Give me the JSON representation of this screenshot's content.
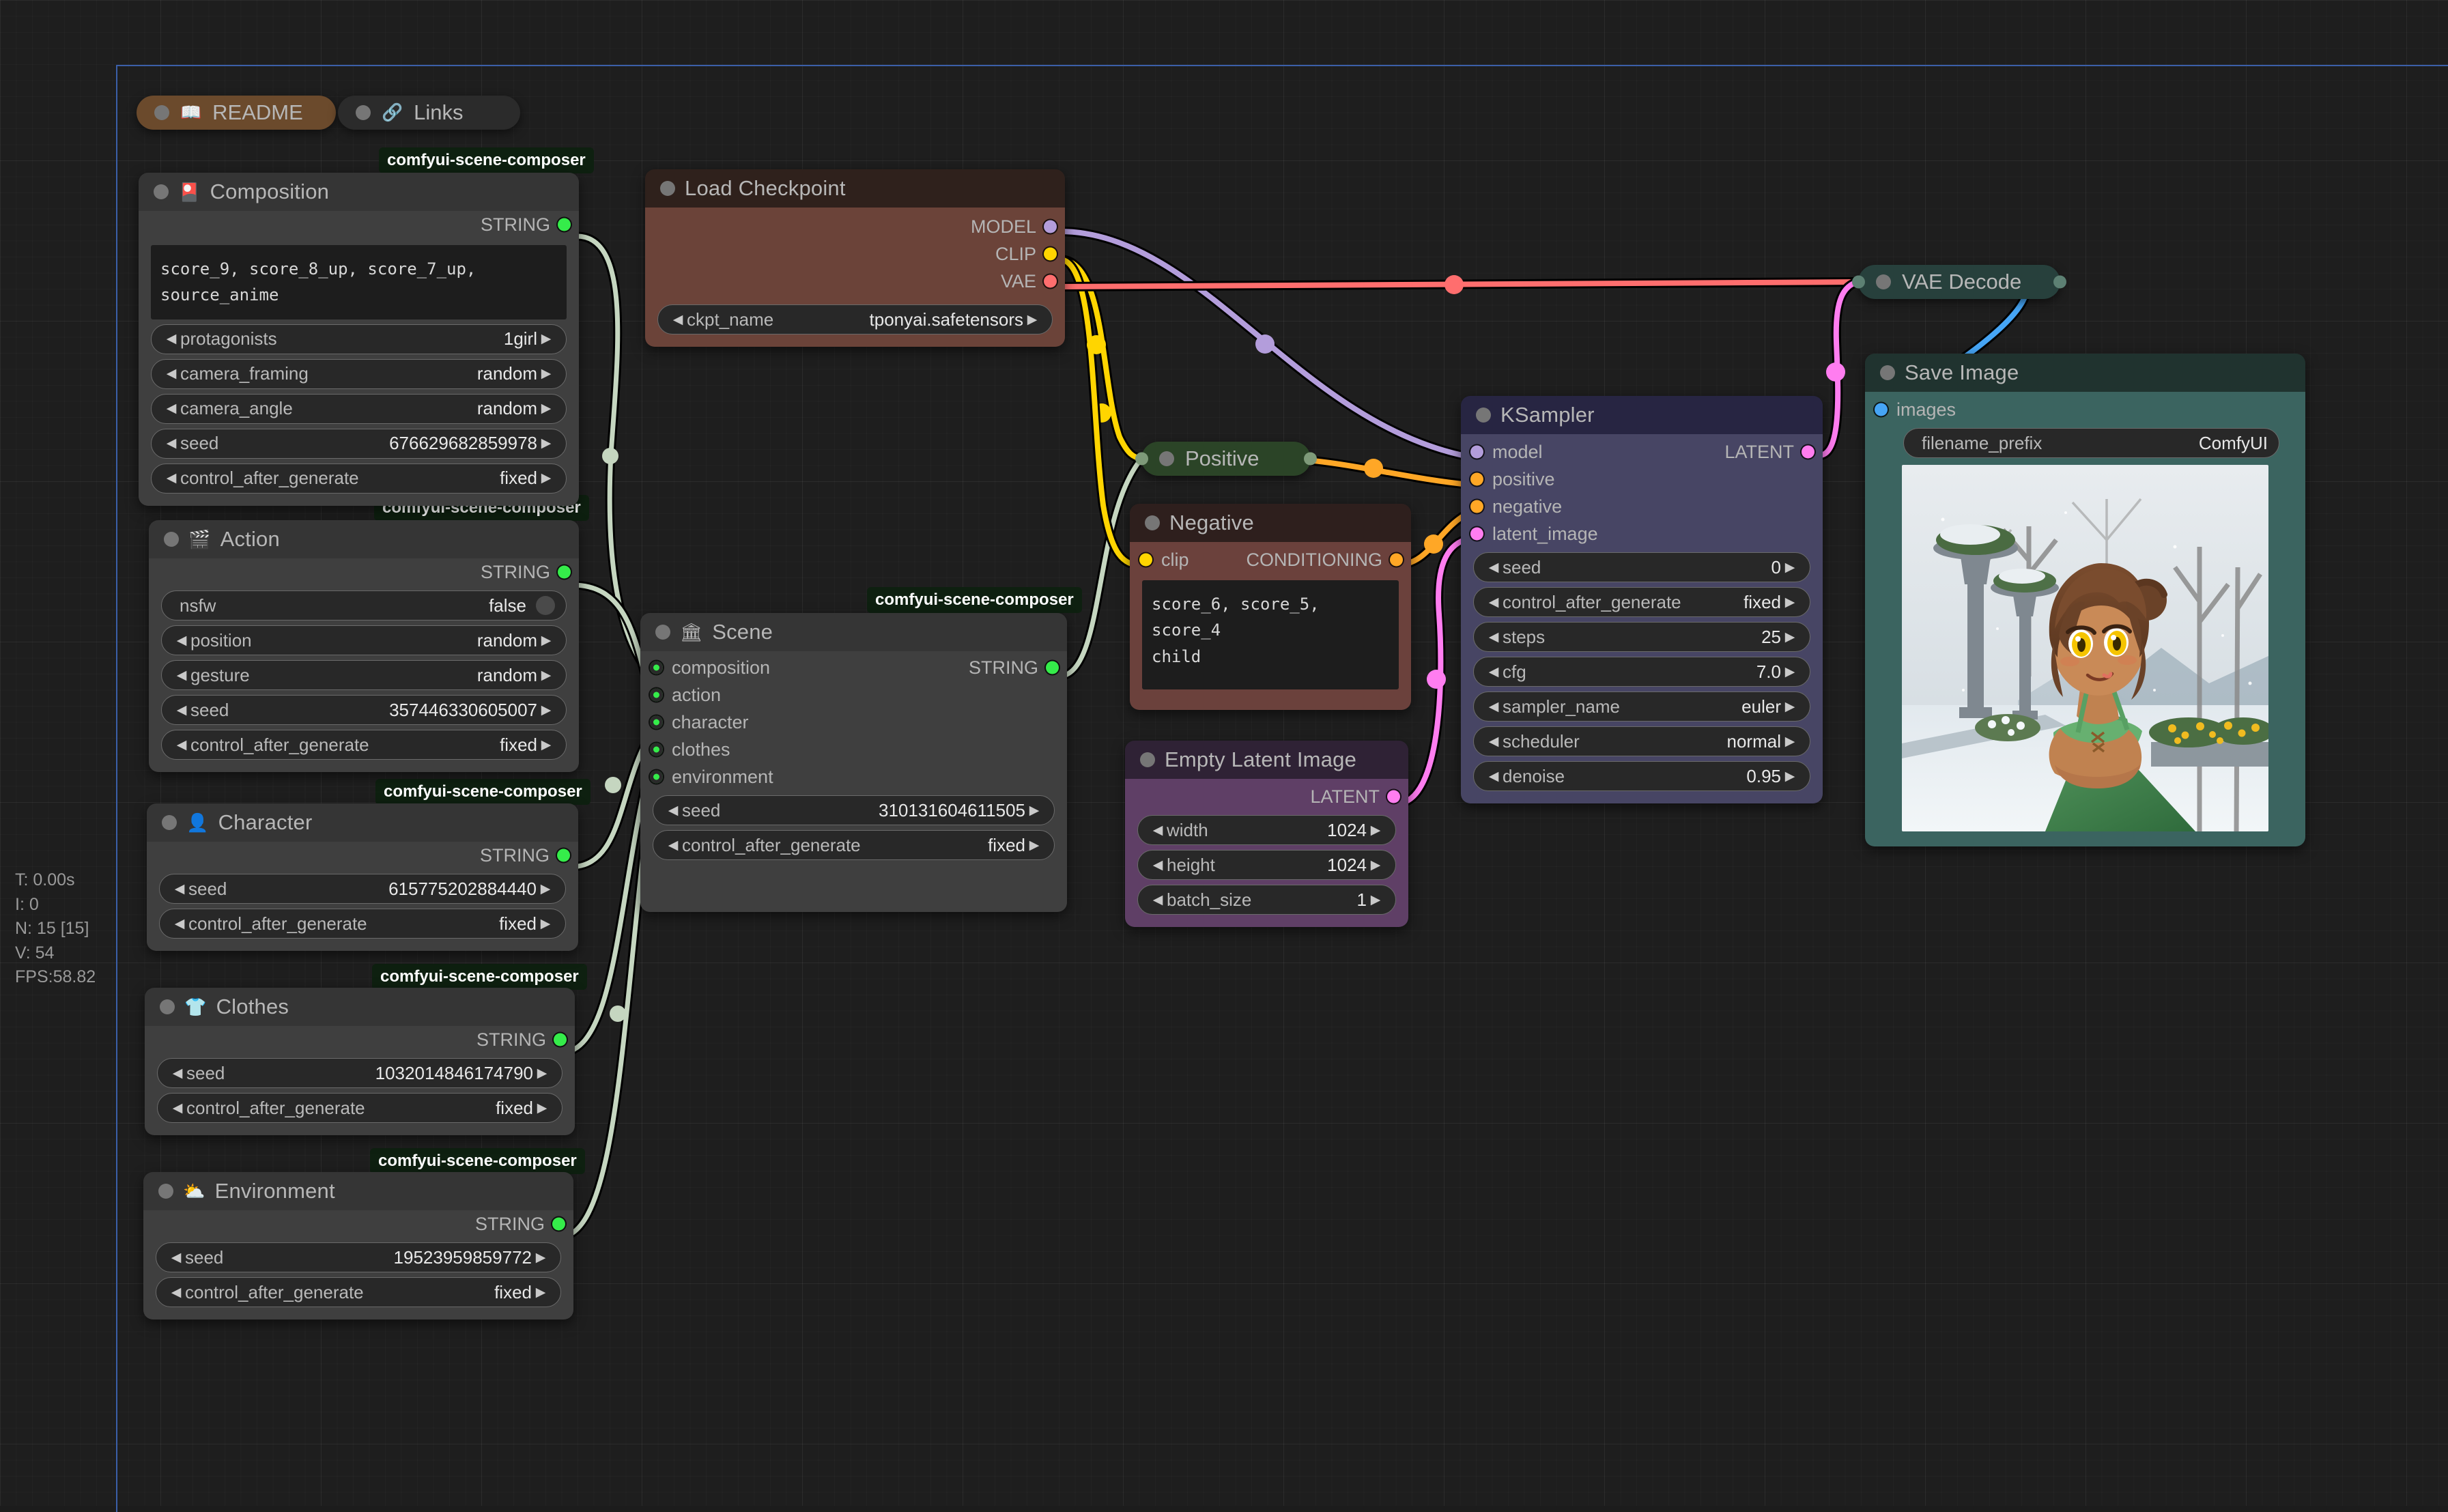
{
  "stats": {
    "time": "T: 0.00s",
    "iterations": "I: 0",
    "nodes": "N: 15 [15]",
    "version": "V: 54",
    "fps": "FPS:58.82"
  },
  "group_badge": "comfyui-scene-composer",
  "pills": {
    "readme": {
      "label": "README",
      "icon": "book-icon",
      "glyph": "📖"
    },
    "links": {
      "label": "Links",
      "icon": "link-icon",
      "glyph": "🔗"
    },
    "positive": {
      "label": "Positive"
    },
    "vae_decode": {
      "label": "VAE Decode"
    }
  },
  "nodes": {
    "composition": {
      "title": "Composition",
      "icon_glyph": "🎴",
      "output_label": "STRING",
      "prompt_text": "score_9, score_8_up, score_7_up, source_anime",
      "widgets": [
        {
          "label": "protagonists",
          "value": "1girl"
        },
        {
          "label": "camera_framing",
          "value": "random"
        },
        {
          "label": "camera_angle",
          "value": "random"
        },
        {
          "label": "seed",
          "value": "676629682859978"
        },
        {
          "label": "control_after_generate",
          "value": "fixed"
        }
      ]
    },
    "action": {
      "title": "Action",
      "icon_glyph": "🎬",
      "output_label": "STRING",
      "toggle": {
        "label": "nsfw",
        "value": "false"
      },
      "widgets": [
        {
          "label": "position",
          "value": "random"
        },
        {
          "label": "gesture",
          "value": "random"
        },
        {
          "label": "seed",
          "value": "357446330605007"
        },
        {
          "label": "control_after_generate",
          "value": "fixed"
        }
      ]
    },
    "character": {
      "title": "Character",
      "icon_glyph": "👤",
      "output_label": "STRING",
      "widgets": [
        {
          "label": "seed",
          "value": "615775202884440"
        },
        {
          "label": "control_after_generate",
          "value": "fixed"
        }
      ]
    },
    "clothes": {
      "title": "Clothes",
      "icon_glyph": "👕",
      "output_label": "STRING",
      "widgets": [
        {
          "label": "seed",
          "value": "1032014846174790"
        },
        {
          "label": "control_after_generate",
          "value": "fixed"
        }
      ]
    },
    "environment": {
      "title": "Environment",
      "icon_glyph": "⛅",
      "output_label": "STRING",
      "widgets": [
        {
          "label": "seed",
          "value": "19523959859772"
        },
        {
          "label": "control_after_generate",
          "value": "fixed"
        }
      ]
    },
    "load_checkpoint": {
      "title": "Load Checkpoint",
      "outputs": [
        "MODEL",
        "CLIP",
        "VAE"
      ],
      "widgets": [
        {
          "label": "ckpt_name",
          "value": "tponyai.safetensors"
        }
      ]
    },
    "scene": {
      "title": "Scene",
      "icon_glyph": "🏛",
      "inputs": [
        "composition",
        "action",
        "character",
        "clothes",
        "environment"
      ],
      "output_label": "STRING",
      "widgets": [
        {
          "label": "seed",
          "value": "310131604611505"
        },
        {
          "label": "control_after_generate",
          "value": "fixed"
        }
      ]
    },
    "negative": {
      "title": "Negative",
      "input_label": "clip",
      "output_label": "CONDITIONING",
      "prompt_text_line1": "score_6, score_5, score_4",
      "prompt_text_line2": "child"
    },
    "empty_latent": {
      "title": "Empty Latent Image",
      "output_label": "LATENT",
      "widgets": [
        {
          "label": "width",
          "value": "1024"
        },
        {
          "label": "height",
          "value": "1024"
        },
        {
          "label": "batch_size",
          "value": "1"
        }
      ]
    },
    "ksampler": {
      "title": "KSampler",
      "inputs": [
        "model",
        "positive",
        "negative",
        "latent_image"
      ],
      "output_label": "LATENT",
      "widgets": [
        {
          "label": "seed",
          "value": "0"
        },
        {
          "label": "control_after_generate",
          "value": "fixed"
        },
        {
          "label": "steps",
          "value": "25"
        },
        {
          "label": "cfg",
          "value": "7.0"
        },
        {
          "label": "sampler_name",
          "value": "euler"
        },
        {
          "label": "scheduler",
          "value": "normal"
        },
        {
          "label": "denoise",
          "value": "0.95"
        }
      ]
    },
    "save_image": {
      "title": "Save Image",
      "input_label": "images",
      "widgets": [
        {
          "label": "filename_prefix",
          "value": "ComfyUI"
        }
      ]
    }
  },
  "colors": {
    "string_link": "#c5d6c0",
    "model_link": "#b39ddb",
    "clip_link": "#ffd500",
    "vae_link": "#ff6e6e",
    "conditioning_link": "#ffa726",
    "latent_link": "#ff7df0",
    "image_link": "#46a5f5",
    "selection": "#3b5fa8"
  }
}
